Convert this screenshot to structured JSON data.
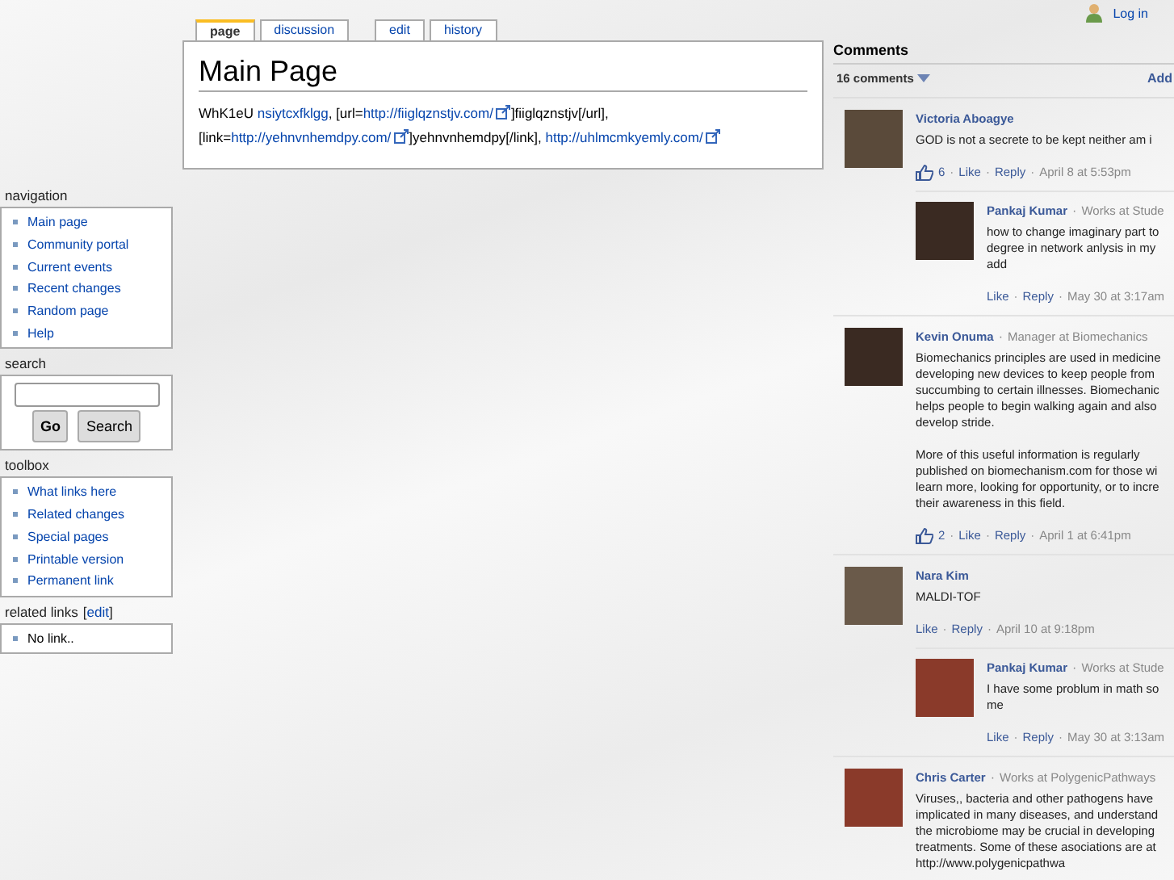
{
  "tabs": [
    {
      "label": "page",
      "selected": true
    },
    {
      "label": "discussion",
      "selected": false
    },
    {
      "label": "edit",
      "selected": false
    },
    {
      "label": "history",
      "selected": false
    }
  ],
  "page": {
    "title": "Main Page",
    "body": [
      {
        "kind": "text",
        "text": "WhK1eU "
      },
      {
        "kind": "link",
        "text": "nsiytcxfklgg"
      },
      {
        "kind": "text",
        "text": ", [url="
      },
      {
        "kind": "external",
        "text": "http://fiiglqznstjv.com/"
      },
      {
        "kind": "text",
        "text": "]fiiglqznstjv[/url], [link="
      },
      {
        "kind": "external",
        "text": "http://yehnvnhemdpy.com/"
      },
      {
        "kind": "text",
        "text": "]yehnvnhemdpy[/link], "
      },
      {
        "kind": "external",
        "text": "http://uhlmcmkyemly.com/"
      }
    ]
  },
  "portlets": [
    {
      "title": "navigation",
      "kind": "links",
      "items": [
        "Main page",
        "Community portal",
        "Current events",
        "Recent changes",
        "Random page",
        "Help"
      ]
    },
    {
      "title": "search",
      "kind": "search",
      "buttons": [
        "Go",
        "Search"
      ]
    },
    {
      "title": "toolbox",
      "kind": "links",
      "items": [
        "What links here",
        "Related changes",
        "Special pages",
        "Printable version",
        "Permanent link"
      ]
    },
    {
      "title": "related links",
      "title_link": "edit",
      "brackets": [
        "[",
        "]"
      ],
      "kind": "plain",
      "items": [
        "No link.."
      ]
    }
  ],
  "login": "Log in",
  "comments": {
    "title": "Comments",
    "count": "16 comments",
    "add": "Add",
    "separator": "·",
    "items": [
      {
        "name": "Victoria Aboagye",
        "paragraphs": [
          [
            "GOD is not a secrete to be kept neither am i"
          ]
        ],
        "likes": "6",
        "like": "Like",
        "reply": "Reply",
        "date": "April 8 at 5:53pm",
        "children": [
          {
            "name": "Pankaj Kumar",
            "meta": "Works at Stude",
            "paragraphs": [
              [
                "how to change imaginary part to",
                "degree in network anlysis in my",
                "add"
              ]
            ],
            "like": "Like",
            "reply": "Reply",
            "date": "May 30 at 3:17am"
          }
        ]
      },
      {
        "name": "Kevin Onuma",
        "meta": "Manager at Biomechanics",
        "paragraphs": [
          [
            "Biomechanics principles are used in medicine",
            "developing new devices to keep people from",
            "succumbing to certain illnesses. Biomechanic",
            "helps people to begin walking again and also",
            "develop stride."
          ],
          [
            "More of this useful information is regularly",
            "published on biomechanism.com for those wi",
            "learn more, looking for opportunity, or to incre",
            "their awareness in this field."
          ]
        ],
        "likes": "2",
        "like": "Like",
        "reply": "Reply",
        "date": "April 1 at 6:41pm"
      },
      {
        "name": "Nara Kim",
        "paragraphs": [
          [
            "MALDI-TOF"
          ]
        ],
        "like": "Like",
        "reply": "Reply",
        "date": "April 10 at 9:18pm",
        "children": [
          {
            "name": "Pankaj Kumar",
            "meta": "Works at Stude",
            "paragraphs": [
              [
                "I have some problum in math so",
                "me"
              ]
            ],
            "like": "Like",
            "reply": "Reply",
            "date": "May 30 at 3:13am"
          }
        ]
      },
      {
        "name": "Chris Carter",
        "meta": "Works at PolygenicPathways",
        "paragraphs": [
          [
            "Viruses,, bacteria and other pathogens have",
            "implicated in many diseases, and understand",
            "the microbiome may be crucial in developing",
            "treatments. Some of these asociations are at",
            "http://www.polygenicpathwa"
          ]
        ]
      }
    ]
  }
}
